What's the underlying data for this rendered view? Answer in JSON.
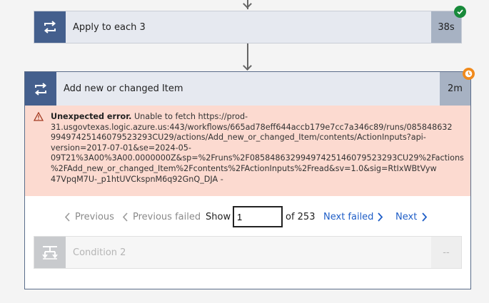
{
  "apply_each": {
    "title": "Apply to each 3",
    "duration": "38s",
    "status_icon": "success-check-icon",
    "status_color": "#188a3a"
  },
  "action": {
    "title": "Add new or changed Item",
    "duration": "2m",
    "status_icon": "running-clock-icon",
    "status_color": "#f08a1c"
  },
  "error": {
    "heading": "Unexpected error.",
    "lines": [
      " Unable to fetch https://prod-",
      "31.usgovtexas.logic.azure.us:443/workflows/665ad78eff644accb179e7cc7a346c89/runs/085848632",
      "99497425146079523293CU29/actions/Add_new_or_changed_Item/contents/ActionInputs?api-",
      "version=2017-07-01&se=2024-05-",
      "09T21%3A00%3A00.0000000Z&sp=%2Fruns%2F08584863299497425146079523293CU29%2Factions",
      "%2FAdd_new_or_changed_Item%2Fcontents%2FActionInputs%2Fread&sv=1.0&sig=RtIxWBtVyw",
      "47VpqM7U-_p1htUVCkspnM6q92GnQ_DJA -"
    ],
    "color": "#fcdad0"
  },
  "pager": {
    "previous": "Previous",
    "previous_failed": "Previous failed",
    "show_label": "Show",
    "page_value": "1",
    "of_label": "of 253",
    "next_failed": "Next failed",
    "next": "Next"
  },
  "condition": {
    "title": "Condition 2",
    "duration": "--"
  }
}
